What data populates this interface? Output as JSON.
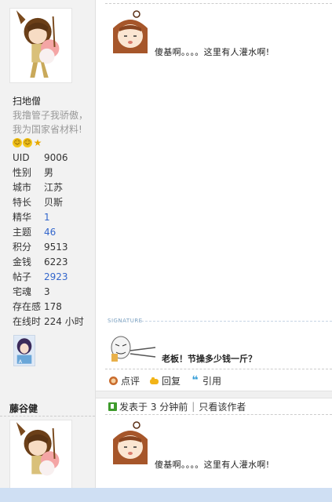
{
  "post1": {
    "author": "扫地僧",
    "signature": "我撸管子我骄傲，我为国家省材料!",
    "badges": [
      "smile-badge-icon",
      "smile-badge-icon",
      "star-badge-icon"
    ],
    "stats": [
      {
        "label": "UID",
        "value": "9006"
      },
      {
        "label": "性别",
        "value": "男"
      },
      {
        "label": "城市",
        "value": "江苏"
      },
      {
        "label": "特长",
        "value": "贝斯"
      },
      {
        "label": "精华",
        "value": "1"
      },
      {
        "label": "主题",
        "value": "46"
      },
      {
        "label": "积分",
        "value": "9513"
      },
      {
        "label": "金钱",
        "value": "6223"
      },
      {
        "label": "帖子",
        "value": "2923"
      },
      {
        "label": "宅魂",
        "value": "3"
      },
      {
        "label": "存在感",
        "value": "178"
      },
      {
        "label": "在线时",
        "value": "224 小时"
      }
    ],
    "content": "傻基啊。。。。这里有人灌水啊!",
    "signature_label": "SIGNATURE",
    "signature_quote": "老板！节操多少钱一斤？",
    "actions": [
      {
        "label": "点评",
        "icon": "comment-icon"
      },
      {
        "label": "回复",
        "icon": "reply-icon"
      },
      {
        "label": "引用",
        "icon": "quote-icon"
      }
    ]
  },
  "post2": {
    "author": "藤谷健",
    "posted": "发表于 3 分钟前",
    "only_author": "只看该作者",
    "content": "傻基啊。。。。这里有人灌水啊!"
  },
  "colors": {
    "sidebar_bg": "#f2f2f2",
    "link_blue": "#3366cc",
    "bottom_bar": "#cfdff3",
    "meta_icon": "#3e9b2c"
  }
}
